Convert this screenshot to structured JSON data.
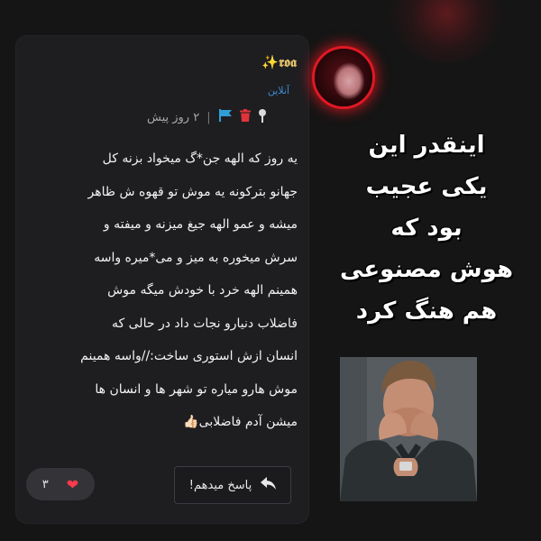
{
  "post": {
    "username": "✨𝖗𝖔𝖆",
    "status": "آنلاین",
    "time": "۲ روز پیش",
    "separator": "|",
    "body_lines": [
      "یه روز که الهه جن*گ میخواد بزنه کل",
      "جهانو بترکونه یه موش تو قهوه ش ظاهر",
      "میشه و عمو الهه جیغ میزنه و میفته و",
      "سرش میخوره به میز و می*میره واسه",
      "همینم الهه خرد با خودش میگه موش",
      "فاضلاب دنیارو نجات داد در حالی که",
      "انسان ازش استوری ساخت://واسه همینم",
      "موش هارو میاره تو شهر ها و انسان ها",
      "میشن آدم فاضلابی"
    ],
    "body_emoji": "👍🏻",
    "reply_label": "پاسخ میدهم!",
    "likes": "۳"
  },
  "caption": {
    "lines": [
      "اینقدر این",
      "یکی عجیب",
      "بود که",
      "هوش مصنوعی",
      "هم هنگ کرد"
    ]
  },
  "icons": {
    "flag": "flag-icon",
    "trash": "trash-icon",
    "pin": "pin-icon",
    "reply": "reply-icon",
    "heart": "heart-icon"
  },
  "colors": {
    "background": "#151515",
    "card": "#1e1e21",
    "username": "#e2c068",
    "status": "#3b8fd4",
    "flag": "#2f9fd8",
    "trash": "#e0343a",
    "heart": "#ff3a4c",
    "avatar_ring": "#e01824"
  }
}
